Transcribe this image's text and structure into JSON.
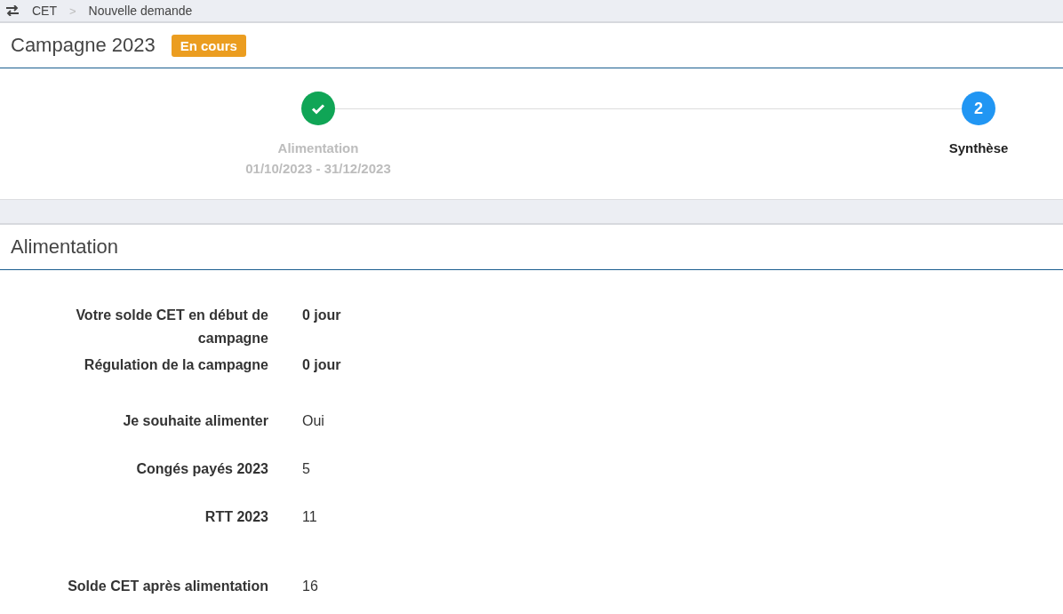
{
  "breadcrumb": {
    "items": [
      "CET",
      "Nouvelle demande"
    ],
    "separator": ">"
  },
  "campaign": {
    "title": "Campagne 2023",
    "status": "En cours"
  },
  "steps": [
    {
      "label": "Alimentation",
      "sublabel": "01/10/2023 - 31/12/2023",
      "completed": true
    },
    {
      "label": "Synthèse",
      "number": "2",
      "completed": false
    }
  ],
  "section": {
    "title": "Alimentation",
    "groups": [
      [
        {
          "label": "Votre solde CET en début de campagne",
          "value": "0 jour",
          "kind": "balance"
        },
        {
          "label": "Régulation de la campagne",
          "value": "0 jour",
          "kind": "balance"
        }
      ],
      [
        {
          "label": "Je souhaite alimenter",
          "value": "Oui",
          "kind": "entry"
        },
        {
          "label": "Congés payés 2023",
          "value": "5",
          "kind": "entry"
        },
        {
          "label": "RTT 2023",
          "value": "11",
          "kind": "entry"
        }
      ],
      [
        {
          "label": "Solde CET après alimentation",
          "value": "16",
          "kind": "entry"
        }
      ]
    ]
  }
}
